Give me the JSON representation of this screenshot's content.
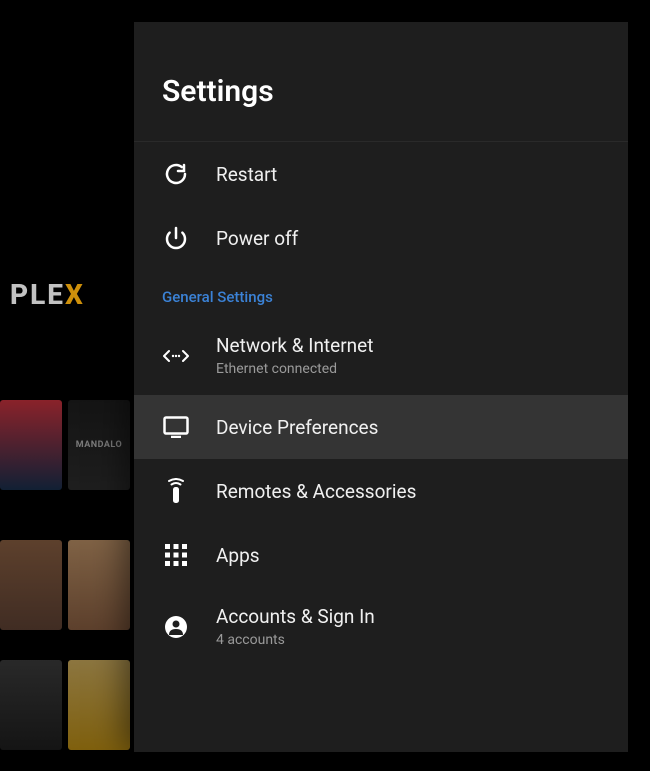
{
  "background": {
    "logo_main": "PLE",
    "logo_accent": "X",
    "tile_label": "MANDALO"
  },
  "panel": {
    "title": "Settings",
    "section_general": "General Settings",
    "items": {
      "restart": {
        "label": "Restart"
      },
      "poweroff": {
        "label": "Power off"
      },
      "network": {
        "label": "Network & Internet",
        "sub": "Ethernet connected"
      },
      "device": {
        "label": "Device Preferences"
      },
      "remotes": {
        "label": "Remotes & Accessories"
      },
      "apps": {
        "label": "Apps"
      },
      "accounts": {
        "label": "Accounts & Sign In",
        "sub": "4 accounts"
      }
    }
  }
}
